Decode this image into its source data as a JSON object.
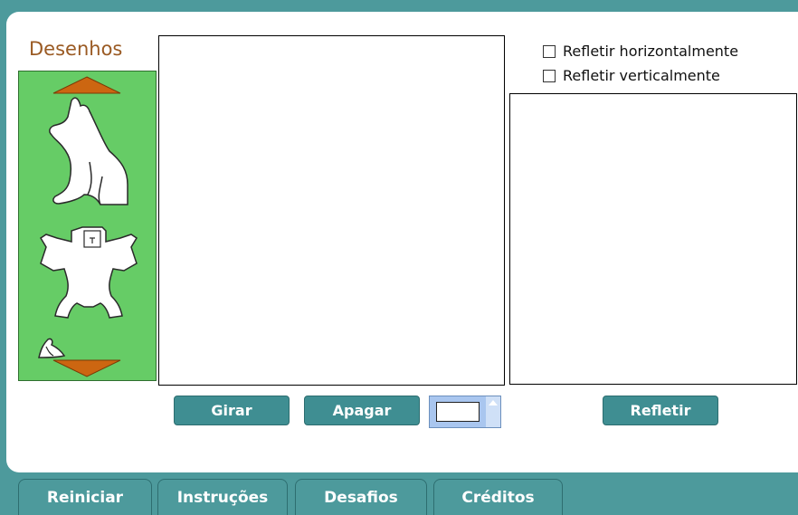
{
  "gallery": {
    "title": "Desenhos"
  },
  "options": {
    "flip_horizontal": {
      "label": "Refletir horizontalmente",
      "checked": false
    },
    "flip_vertical": {
      "label": "Refletir verticalmente",
      "checked": false
    }
  },
  "buttons": {
    "rotate": "Girar",
    "erase": "Apagar",
    "reflect": "Refletir"
  },
  "tabs": [
    "Reiniciar",
    "Instruções",
    "Desafios",
    "Créditos"
  ],
  "colors": {
    "background": "#4d9a9c",
    "gallery_bg": "#66cc66",
    "arrow": "#cc6611",
    "button": "#3f8e92",
    "title": "#9a5a23"
  },
  "icons": [
    "arrow-up-icon",
    "arrow-down-icon",
    "dog-figure-icon",
    "human-figure-icon",
    "bird-figure-icon",
    "checkbox-icon"
  ]
}
